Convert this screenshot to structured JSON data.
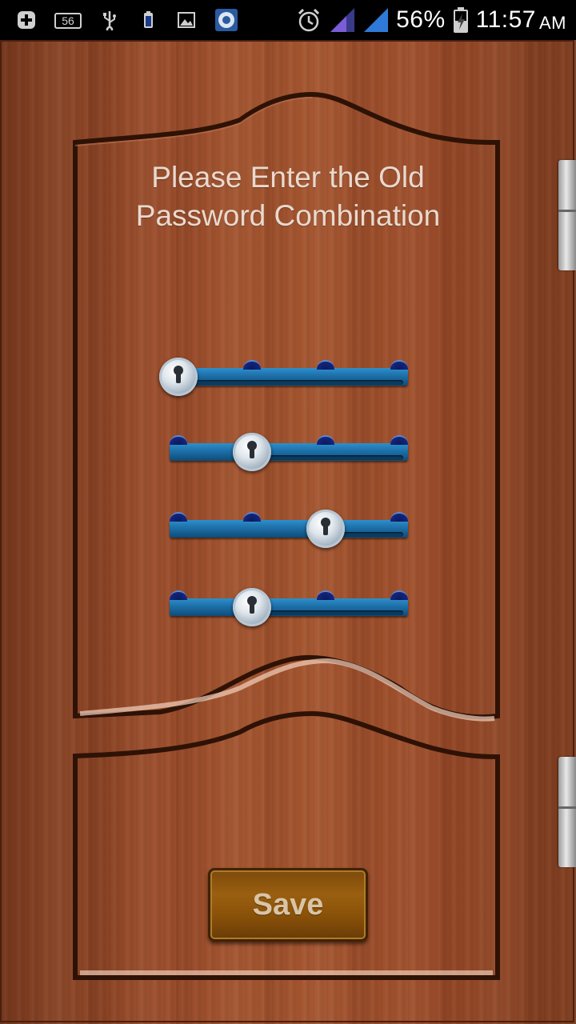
{
  "status_bar": {
    "battery_percent": "56%",
    "time": "11:57",
    "ampm": "AM",
    "notification_badge": "56",
    "icons": [
      "add-icon",
      "notification-56-icon",
      "usb-icon",
      "battery-small-icon",
      "image-icon",
      "app-icon",
      "alarm-icon",
      "signal-1-icon",
      "signal-2-icon",
      "battery-charging-icon"
    ]
  },
  "prompt": {
    "line1": "Please Enter the Old",
    "line2": "Password Combination"
  },
  "combination": {
    "positions": 4,
    "values": [
      1,
      2,
      3,
      2
    ]
  },
  "save_button": {
    "label": "Save"
  },
  "colors": {
    "wood": "#9b4d2b",
    "track": "#1d6fa8",
    "button": "#9a5f10",
    "title_text": "#e9d9cf"
  }
}
